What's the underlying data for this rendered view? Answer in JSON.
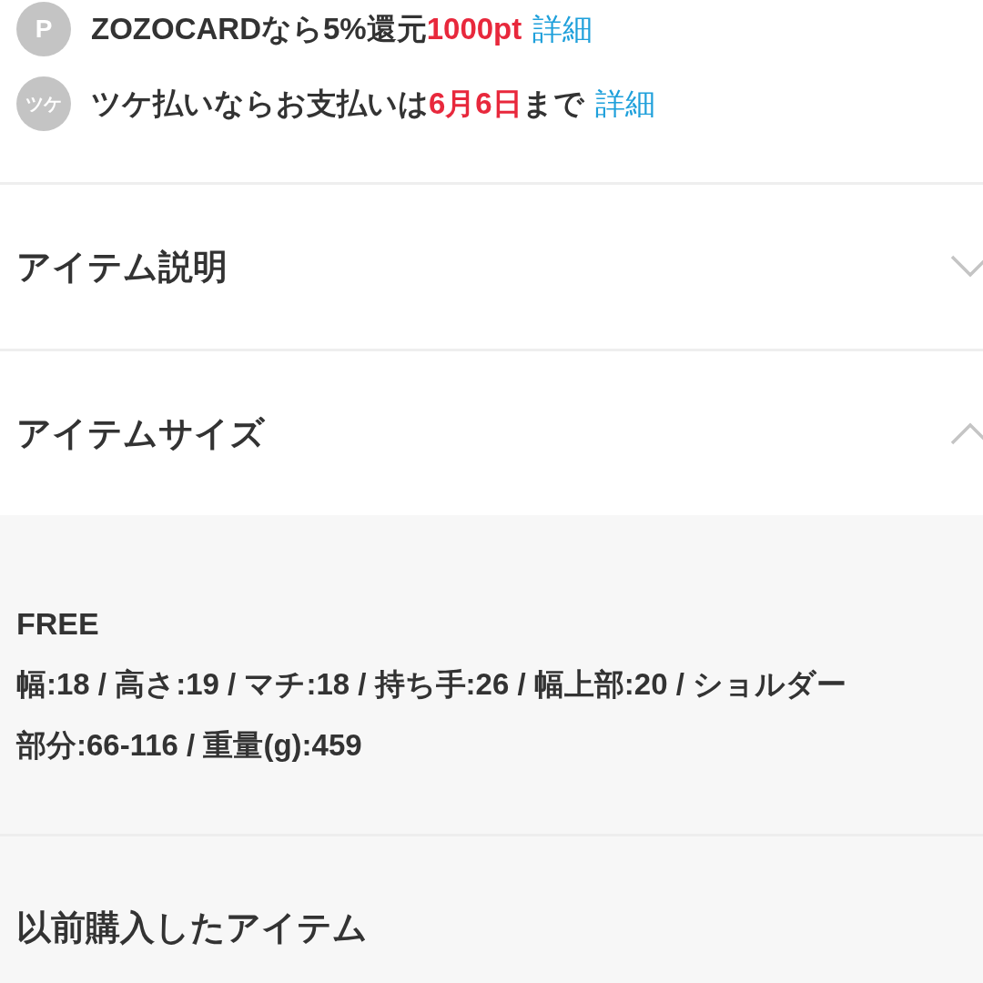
{
  "benefits": [
    {
      "icon": "P",
      "segments": [
        {
          "kind": "plain",
          "text": "ZOZOCARDなら5%還元"
        },
        {
          "kind": "highlight",
          "text": "1000pt"
        }
      ],
      "link": "詳細"
    },
    {
      "icon": "ツケ",
      "segments": [
        {
          "kind": "plain",
          "text": "ツケ払いならお支払いは"
        },
        {
          "kind": "highlight",
          "text": "6月6日"
        },
        {
          "kind": "plain",
          "text": "まで"
        }
      ],
      "link": "詳細"
    }
  ],
  "sections": [
    {
      "title": "アイテム説明",
      "expanded": false
    },
    {
      "title": "アイテムサイズ",
      "expanded": true,
      "size_name": "FREE",
      "size_details": "幅:18 / 高さ:19 / マチ:18 / 持ち手:26 / 幅上部:20 / ショルダー部分:66-116 / 重量(g):459"
    }
  ],
  "history": {
    "title": "以前購入したアイテム"
  }
}
